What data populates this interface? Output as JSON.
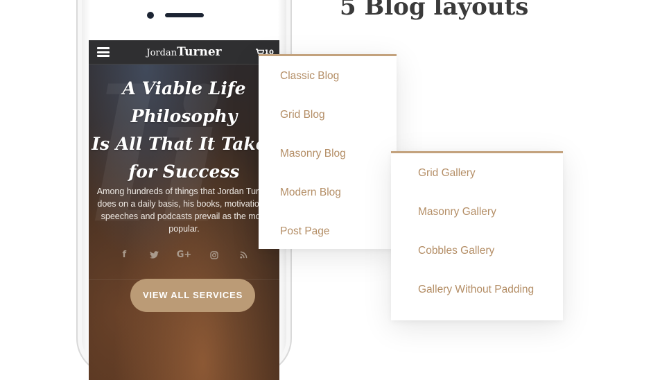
{
  "section_title": "5 Blog layouts",
  "phone": {
    "header": {
      "brand_first": "Jordan",
      "brand_last": "Turner",
      "cart_count": "10"
    },
    "hero": {
      "title_lines": [
        "A Viable Life",
        "Philosophy",
        "Is All That It Takes",
        "for Success"
      ],
      "description": "Among hundreds of things that Jordan Turner does on a daily basis, his books, motivational speeches and podcasts prevail as the most popular.",
      "social_icons": [
        "facebook-icon",
        "twitter-icon",
        "google-plus-icon",
        "instagram-icon",
        "rss-icon"
      ],
      "cta_label": "VIEW ALL SERVICES"
    }
  },
  "blog_menu": {
    "items": [
      {
        "label": "Classic Blog"
      },
      {
        "label": "Grid Blog"
      },
      {
        "label": "Masonry Blog"
      },
      {
        "label": "Modern Blog"
      },
      {
        "label": "Post Page"
      }
    ]
  },
  "gallery_menu": {
    "items": [
      {
        "label": "Grid Gallery"
      },
      {
        "label": "Masonry Gallery"
      },
      {
        "label": "Cobbles Gallery"
      },
      {
        "label": "Gallery Without Padding"
      }
    ]
  },
  "colors": {
    "accent": "#c3a27d",
    "link": "#b48e66",
    "button": "#bb9b76",
    "heading": "#3a3a3a"
  }
}
